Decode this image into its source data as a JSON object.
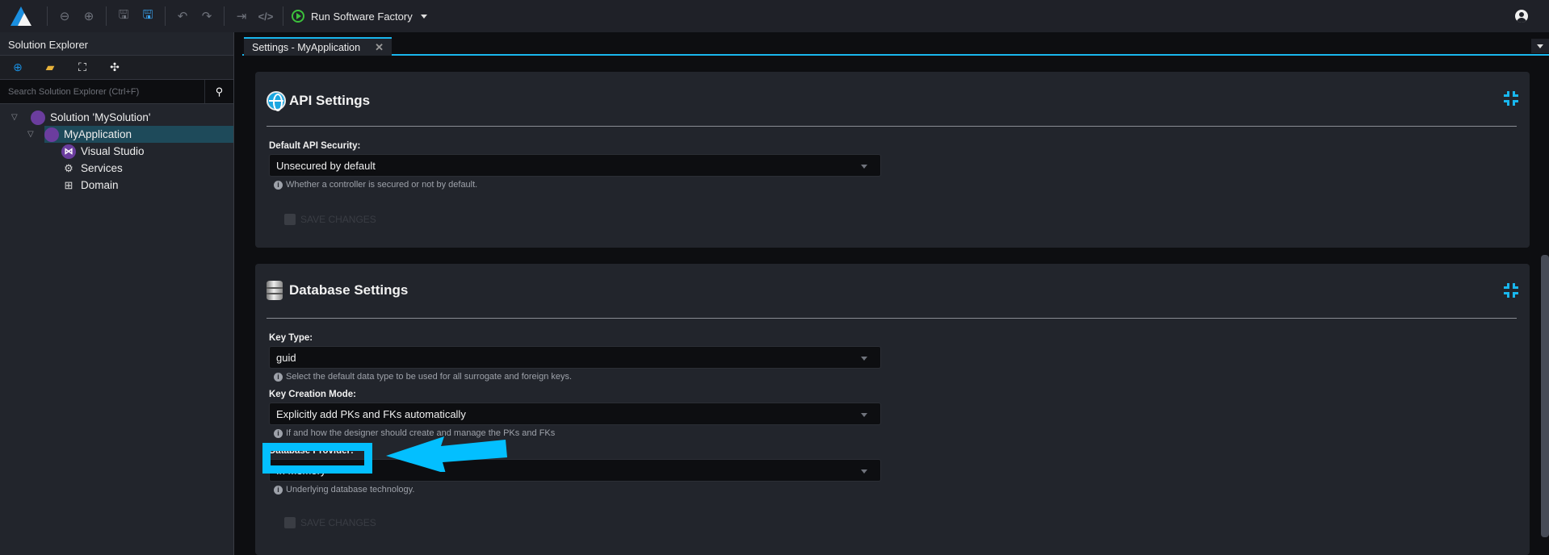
{
  "toolbar": {
    "logo": "intent-architect-logo",
    "buttons": [
      "back-icon",
      "forward-icon",
      "save-icon",
      "save-all-icon",
      "undo-icon",
      "redo-icon",
      "export-icon",
      "code-icon"
    ],
    "run_label": "Run Software Factory"
  },
  "sidebar": {
    "title": "Solution Explorer",
    "search_placeholder": "Search Solution Explorer (Ctrl+F)",
    "tree": [
      {
        "label": "Solution 'MySolution'",
        "level": 0,
        "expanded": true
      },
      {
        "label": "MyApplication",
        "level": 1,
        "expanded": true,
        "selected": true
      },
      {
        "label": "Visual Studio",
        "level": 2
      },
      {
        "label": "Services",
        "level": 2
      },
      {
        "label": "Domain",
        "level": 2
      }
    ]
  },
  "editor": {
    "tab_label": "Settings - MyApplication",
    "accent": "#19b7ee",
    "api": {
      "title": "API Settings",
      "fields": [
        {
          "label": "Default API Security:",
          "value": "Unsecured by default",
          "hint": "Whether a controller is secured or not by default."
        }
      ],
      "save_label": "SAVE CHANGES"
    },
    "database": {
      "title": "Database Settings",
      "fields": [
        {
          "label": "Key Type:",
          "value": "guid",
          "hint": "Select the default data type to be used for all surrogate and foreign keys."
        },
        {
          "label": "Key Creation Mode:",
          "value": "Explicitly add PKs and FKs automatically",
          "hint": "If and how the designer should create and manage the PKs and FKs"
        },
        {
          "label": "Database Provider:",
          "value": "In Memory",
          "hint": "Underlying database technology."
        }
      ],
      "save_label": "SAVE CHANGES"
    }
  },
  "annotation": {
    "color": "#03bfff",
    "target": "Database Provider:"
  }
}
